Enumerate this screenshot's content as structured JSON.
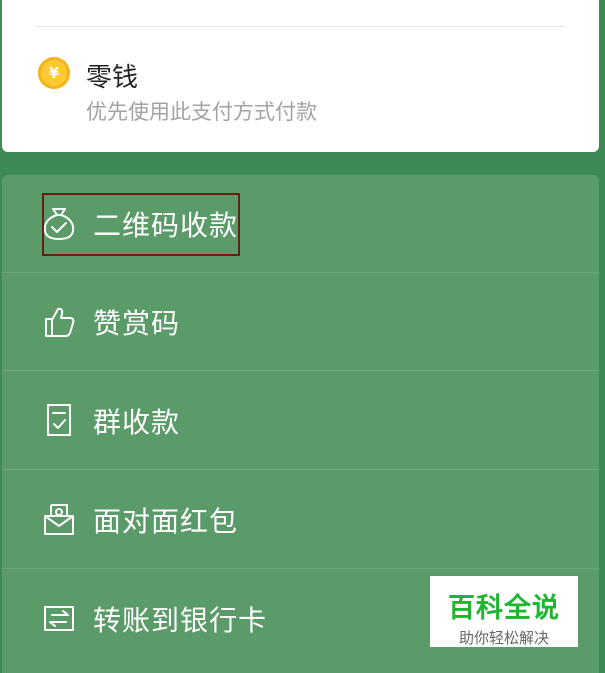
{
  "payment_method": {
    "coin_glyph": "¥",
    "title": "零钱",
    "subtitle": "优先使用此支付方式付款"
  },
  "menu": {
    "items": [
      {
        "label": "二维码收款",
        "icon": "money-bag-check-icon"
      },
      {
        "label": "赞赏码",
        "icon": "thumbs-up-icon"
      },
      {
        "label": "群收款",
        "icon": "receipt-check-icon"
      },
      {
        "label": "面对面红包",
        "icon": "envelope-face-icon"
      },
      {
        "label": "转账到银行卡",
        "icon": "bank-transfer-icon"
      }
    ]
  },
  "watermark": {
    "title": "百科全说",
    "subtitle": "助你轻松解决"
  },
  "colors": {
    "background": "#3e8a55",
    "menu": "#5b9a69",
    "highlight_border": "#6d1e14",
    "coin": "#ffc933",
    "watermark_green": "#1eb52f"
  }
}
